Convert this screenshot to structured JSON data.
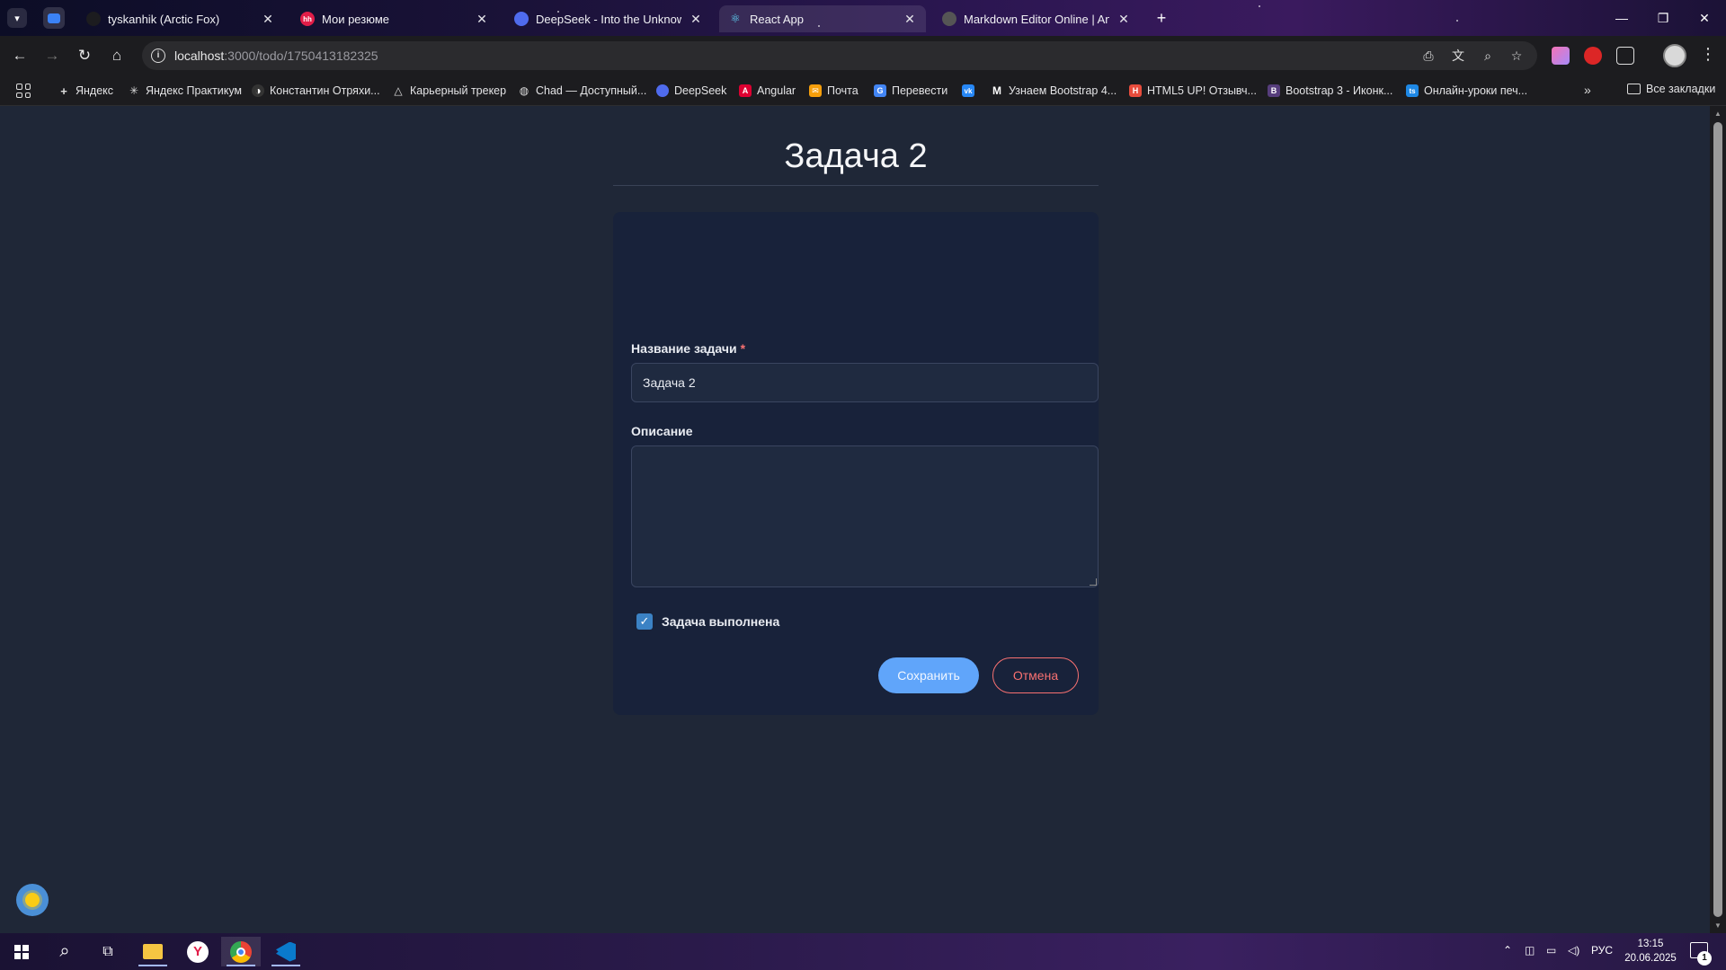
{
  "browser": {
    "tabs": [
      {
        "title": "tyskanhik (Arctic Fox)",
        "favicon_color": "#1c1c1f",
        "favicon_text": ""
      },
      {
        "title": "Мои резюме",
        "favicon_color": "#e11d48",
        "favicon_text": "hh"
      },
      {
        "title": "DeepSeek - Into the Unknown",
        "favicon_color": "#4f6bed",
        "favicon_text": ""
      },
      {
        "title": "React App",
        "favicon_color": "#1c2b3a",
        "favicon_text": "⚛"
      },
      {
        "title": "Markdown Editor Online | Ando",
        "favicon_color": "#555",
        "favicon_text": ""
      }
    ],
    "close_glyph": "✕",
    "new_tab_glyph": "+",
    "url_host": "localhost",
    "url_path": ":3000/todo/1750413182325"
  },
  "bookmarks": {
    "items": [
      {
        "label": "Яндекс",
        "icon_color": "transparent",
        "icon_text": "+"
      },
      {
        "label": "Яндекс Практикум",
        "icon_color": "transparent",
        "icon_text": "✳"
      },
      {
        "label": "Константин Отряхи...",
        "icon_color": "#333",
        "icon_text": "◑"
      },
      {
        "label": "Карьерный трекер",
        "icon_color": "transparent",
        "icon_text": "△"
      },
      {
        "label": "Chad — Доступный...",
        "icon_color": "transparent",
        "icon_text": "◍"
      },
      {
        "label": "DeepSeek",
        "icon_color": "#4f6bed",
        "icon_text": ""
      },
      {
        "label": "Angular",
        "icon_color": "#dd0031",
        "icon_text": "A"
      },
      {
        "label": "Почта",
        "icon_color": "#f59e0b",
        "icon_text": "✉"
      },
      {
        "label": "Перевести",
        "icon_color": "#4285f4",
        "icon_text": "G"
      },
      {
        "label": "",
        "icon_color": "#2787f5",
        "icon_text": "vk"
      },
      {
        "label": "Узнаем Bootstrap 4...",
        "icon_color": "transparent",
        "icon_text": "M"
      },
      {
        "label": "HTML5 UP! Отзывч...",
        "icon_color": "#e74c3c",
        "icon_text": "H"
      },
      {
        "label": "Bootstrap 3 - Иконк...",
        "icon_color": "#563d7c",
        "icon_text": "B"
      },
      {
        "label": "Онлайн-уроки печ...",
        "icon_color": "#1e88e5",
        "icon_text": "ts"
      }
    ],
    "more_glyph": "»",
    "all_label": "Все закладки"
  },
  "form": {
    "page_title": "Задача 2",
    "name_label": "Название задачи",
    "required_mark": "*",
    "name_value": "Задача 2",
    "description_label": "Описание",
    "description_value": "",
    "completed_label": "Задача выполнена",
    "completed": true,
    "check_glyph": "✓",
    "save_label": "Сохранить",
    "cancel_label": "Отмена"
  },
  "taskbar": {
    "language": "РУС",
    "time": "13:15",
    "date": "20.06.2025",
    "notification_count": "1"
  },
  "colors": {
    "page_bg": "#1f2737",
    "card_bg": "#18223a",
    "save_button": "#60a5fa",
    "cancel_button": "#f87171",
    "required_mark": "#f87171"
  }
}
